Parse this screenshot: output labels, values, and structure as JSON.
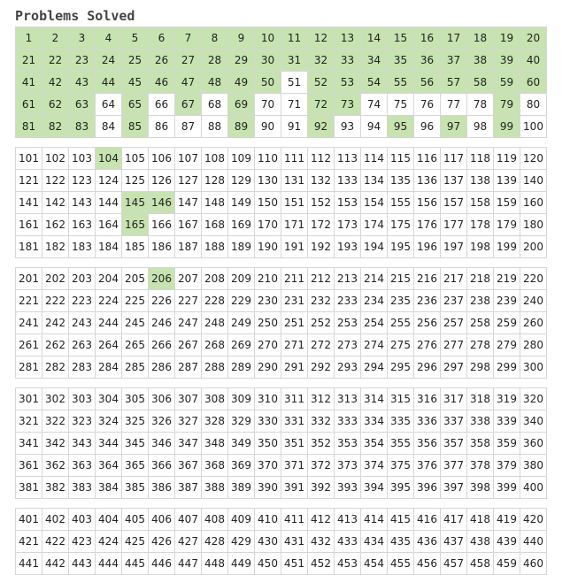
{
  "page": {
    "title": "Problems Solved"
  },
  "colors": {
    "solved": "#c6e3b0",
    "unsolved": "#ffffff",
    "border": "#d6d6d6"
  },
  "grids": [
    {
      "start": 1,
      "end": 100,
      "solved": [
        1,
        2,
        3,
        4,
        5,
        6,
        7,
        8,
        9,
        10,
        11,
        12,
        13,
        14,
        15,
        16,
        17,
        18,
        19,
        20,
        21,
        22,
        23,
        24,
        25,
        26,
        27,
        28,
        29,
        30,
        31,
        32,
        33,
        34,
        35,
        36,
        37,
        38,
        39,
        40,
        41,
        42,
        43,
        44,
        45,
        46,
        47,
        48,
        49,
        50,
        52,
        53,
        54,
        55,
        56,
        57,
        58,
        59,
        60,
        61,
        62,
        63,
        65,
        67,
        69,
        72,
        73,
        79,
        81,
        82,
        83,
        85,
        89,
        92,
        95,
        97,
        99
      ]
    },
    {
      "start": 101,
      "end": 200,
      "solved": [
        104,
        145,
        146,
        165
      ]
    },
    {
      "start": 201,
      "end": 300,
      "solved": [
        206
      ]
    },
    {
      "start": 301,
      "end": 400,
      "solved": []
    },
    {
      "start": 401,
      "end": 460,
      "solved": []
    }
  ]
}
